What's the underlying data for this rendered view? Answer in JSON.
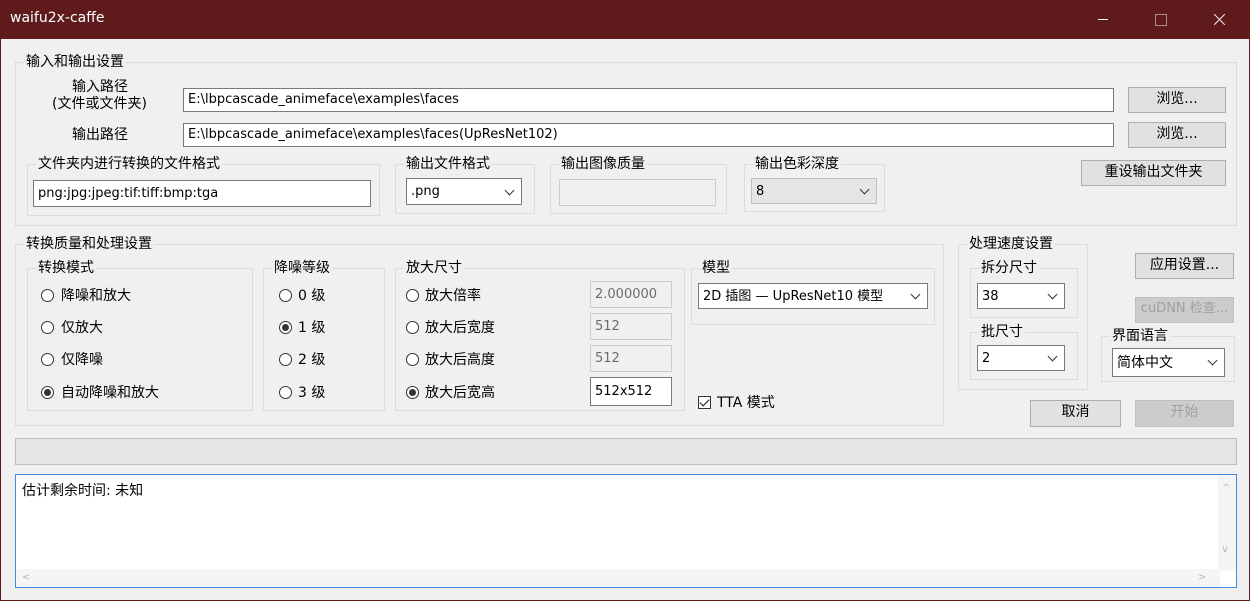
{
  "window": {
    "title": "waifu2x-caffe"
  },
  "io": {
    "group_label": "输入和输出设置",
    "input_label_line1": "输入路径",
    "input_label_line2": "(文件或文件夹)",
    "input_value": "E:\\lbpcascade_animeface\\examples\\faces",
    "browse_label": "浏览...",
    "output_label": "输出路径",
    "output_value": "E:\\lbpcascade_animeface\\examples\\faces(UpResNet102)",
    "folder_format_label": "文件夹内进行转换的文件格式",
    "folder_format_value": "png:jpg:jpeg:tif:tiff:bmp:tga",
    "output_format_label": "输出文件格式",
    "output_format_value": ".png",
    "quality_label": "输出图像质量",
    "quality_value": "",
    "depth_label": "输出色彩深度",
    "depth_value": "8",
    "reset_label": "重设输出文件夹"
  },
  "conversion": {
    "group_label": "转换质量和处理设置",
    "mode": {
      "label": "转换模式",
      "options": [
        "降噪和放大",
        "仅放大",
        "仅降噪",
        "自动降噪和放大"
      ],
      "selected": "自动降噪和放大"
    },
    "noise": {
      "label": "降噪等级",
      "options": [
        "0 级",
        "1 级",
        "2 级",
        "3 级"
      ],
      "selected": "1 级"
    },
    "scale": {
      "label": "放大尺寸",
      "options": [
        "放大倍率",
        "放大后宽度",
        "放大后高度",
        "放大后宽高"
      ],
      "values": [
        "2.000000",
        "512",
        "512",
        "512x512"
      ],
      "selected": "放大后宽高"
    },
    "model": {
      "label": "模型",
      "value": "2D 插图 — UpResNet10 模型"
    },
    "tta": {
      "label": "TTA 模式",
      "checked": true
    }
  },
  "speed": {
    "group_label": "处理速度设置",
    "split_label": "拆分尺寸",
    "split_value": "38",
    "batch_label": "批尺寸",
    "batch_value": "2"
  },
  "right": {
    "apply_label": "应用设置...",
    "cudnn_label": "cuDNN 检查...",
    "language_label": "界面语言",
    "language_value": "简体中文",
    "cancel_label": "取消",
    "start_label": "开始"
  },
  "status": {
    "log_text": "估计剩余时间: 未知"
  }
}
